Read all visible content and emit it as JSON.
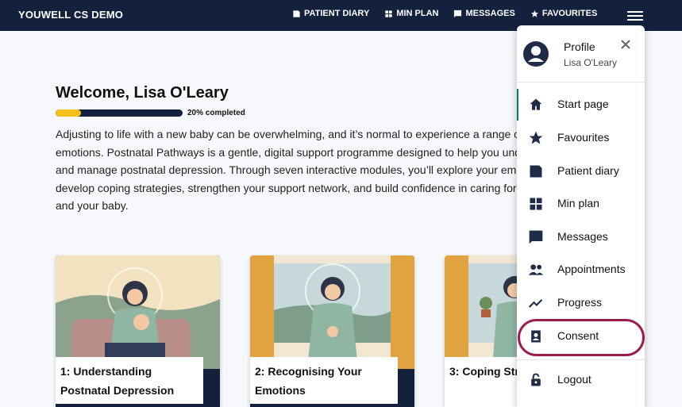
{
  "header": {
    "brand": "YOUWELL CS DEMO",
    "nav": [
      {
        "label": "PATIENT DIARY",
        "icon": "diary-icon"
      },
      {
        "label": "MIN PLAN",
        "icon": "plan-icon"
      },
      {
        "label": "MESSAGES",
        "icon": "message-icon"
      },
      {
        "label": "FAVOURITES",
        "icon": "star-icon"
      }
    ],
    "menu_icon": "hamburger-icon"
  },
  "main": {
    "welcome": "Welcome, Lisa O'Leary",
    "progress": {
      "percent": 20,
      "label": "20% completed"
    },
    "intro": "Adjusting to life with a new baby can be overwhelming, and it’s normal to experience a range of emotions. Postnatal Pathways is a gentle, digital support programme designed to help you understand and manage postnatal depression. Through seven interactive modules, you’ll explore your emotions, develop coping strategies, strengthen your support network, and build confidence in caring for yourself and your baby.",
    "modules": [
      {
        "title": "1: Understanding Postnatal Depression"
      },
      {
        "title": "2: Recognising Your Emotions"
      },
      {
        "title": "3: Coping Strategies"
      }
    ]
  },
  "menu": {
    "profile_title": "Profile",
    "profile_name": "Lisa O'Leary",
    "items": [
      {
        "label": "Start page",
        "icon": "home-icon"
      },
      {
        "label": "Favourites",
        "icon": "star-icon"
      },
      {
        "label": "Patient diary",
        "icon": "diary-icon"
      },
      {
        "label": "Min plan",
        "icon": "plan-icon"
      },
      {
        "label": "Messages",
        "icon": "message-icon"
      },
      {
        "label": "Appointments",
        "icon": "people-icon"
      },
      {
        "label": "Progress",
        "icon": "trend-icon"
      },
      {
        "label": "Consent",
        "icon": "consent-icon"
      },
      {
        "label": "Logout",
        "icon": "lock-icon"
      }
    ],
    "highlighted_item": "Consent"
  },
  "colors": {
    "header_bg": "#13213d",
    "progress_fill": "#f5c019",
    "highlight_ring": "#9b1d4d",
    "active_bar": "#0d7a7a"
  }
}
